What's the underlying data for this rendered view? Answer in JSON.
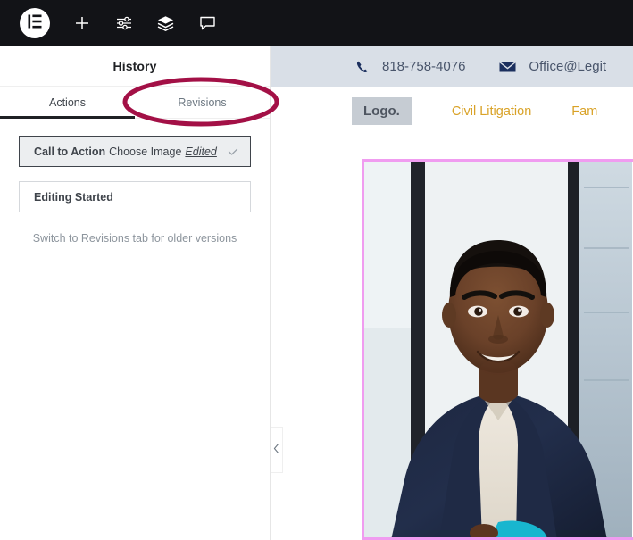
{
  "toolbar": {
    "items": [
      {
        "name": "elementor-logo",
        "label": "Elementor"
      },
      {
        "name": "add-element",
        "label": "Add Element"
      },
      {
        "name": "settings-sliders",
        "label": "Settings"
      },
      {
        "name": "layers",
        "label": "Navigator"
      },
      {
        "name": "comments",
        "label": "Comments"
      }
    ]
  },
  "panel": {
    "title": "History",
    "tabs": [
      {
        "label": "Actions",
        "active": true
      },
      {
        "label": "Revisions",
        "active": false
      }
    ],
    "history_items": [
      {
        "main": "Call to Action",
        "sub": "Choose Image",
        "emphasis": "Edited",
        "current": true,
        "check": "✓"
      },
      {
        "main": "Editing Started",
        "sub": "",
        "emphasis": "",
        "current": false,
        "check": ""
      }
    ],
    "note": "Switch to Revisions tab for older versions",
    "collapse_icon": "‹"
  },
  "preview": {
    "topbar": {
      "phone_icon": "phone-icon",
      "phone": "818-758-4076",
      "email_icon": "envelope-icon",
      "email": "Office@Legit"
    },
    "nav": {
      "logo": "Logo.",
      "links": [
        "Civil Litigation",
        "Fam"
      ]
    },
    "image": {
      "alt": "portrait-man-navy-cardigan",
      "selected": true
    }
  },
  "annotation": {
    "shape": "ellipse",
    "target": "Revisions",
    "color": "#a31046"
  },
  "colors": {
    "toolbar_bg": "#121317",
    "panel_bg": "#ffffff",
    "site_topbar_bg": "#d9dfe7",
    "nav_link": "#d9a227",
    "selection_border": "#f09cf0",
    "annotation": "#a31046",
    "active_tab_underline": "#1f2124"
  }
}
